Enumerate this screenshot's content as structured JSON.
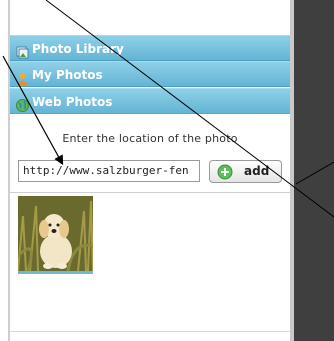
{
  "sidebar": {
    "sections": [
      {
        "label": "Photo Library",
        "icon": "photo-library-icon"
      },
      {
        "label": "My Photos",
        "icon": "user-icon"
      },
      {
        "label": "Web Photos",
        "icon": "globe-icon"
      }
    ]
  },
  "web_photos": {
    "instruction": "Enter the location of the photo",
    "url_value": "http://www.salzburger-fen",
    "add_label": "add"
  },
  "colors": {
    "header_bg": "#64b4d4",
    "header_text": "#ffffff",
    "dark_area": "#3f3f3f",
    "add_icon_green": "#4caf50"
  },
  "thumbnails": [
    {
      "subject": "puppy in grass"
    }
  ]
}
